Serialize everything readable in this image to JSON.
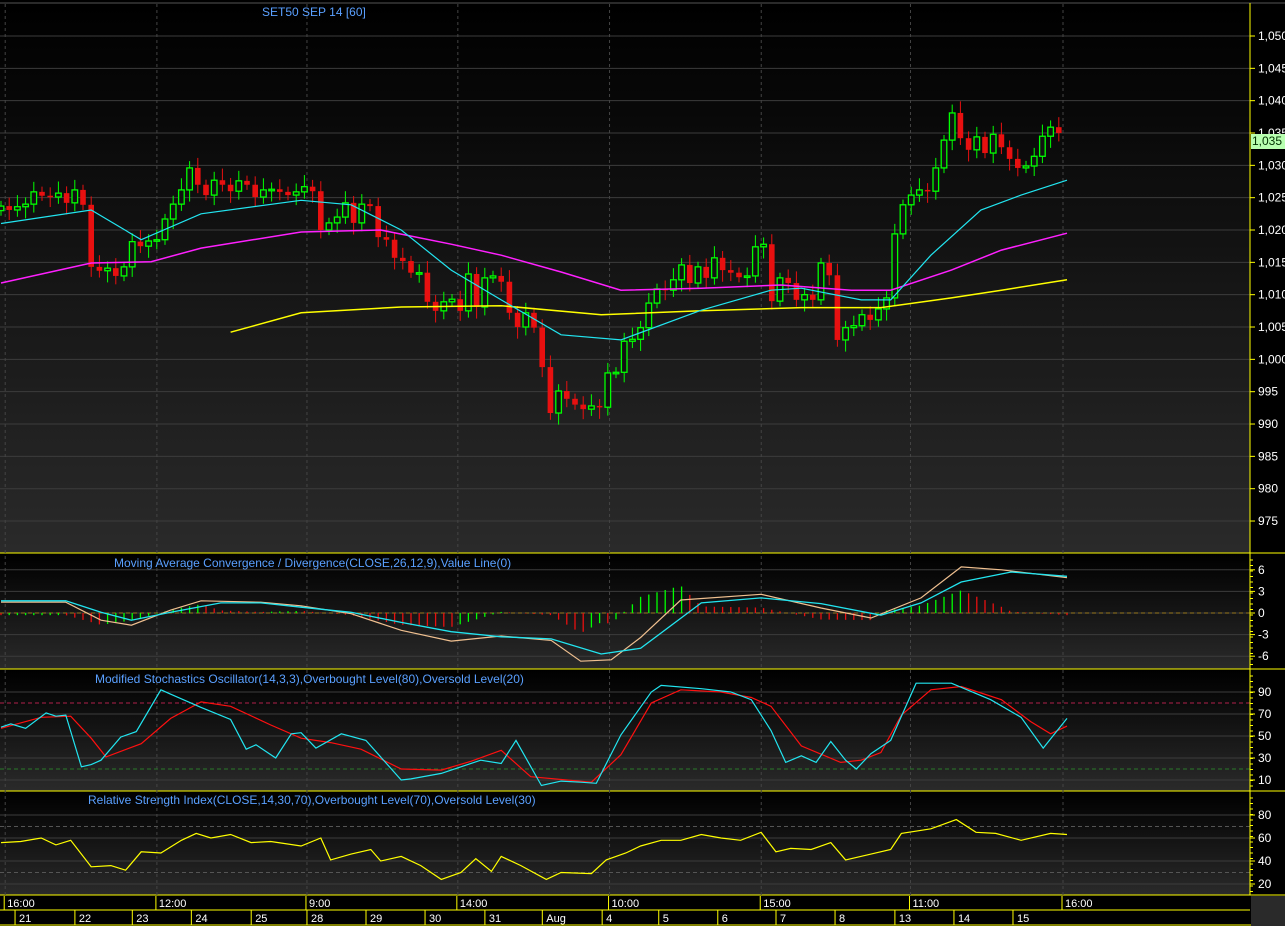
{
  "title": "SET50 SEP 14   [60]",
  "current_price_label": "1,035",
  "colors": {
    "up": "#00ff00",
    "down": "#e81010",
    "ma_fast": "#22e5f0",
    "ma_mid": "#ff20ff",
    "ma_slow": "#ffff00",
    "axis": "#ffff00",
    "title": "#5aa0ff"
  },
  "panels": {
    "macd_title": "Moving Average Convergence / Divergence(CLOSE,26,12,9),Value Line(0)",
    "stoch_title": "Modified Stochastics Oscillator(14,3,3),Overbought Level(80),Oversold Level(20)",
    "rsi_title": "Relative Strength Index(CLOSE,14,30,70),Overbought Level(70),Oversold Level(30)"
  },
  "time_axis": {
    "time_labels": [
      {
        "bar": 1,
        "label": "16:00"
      },
      {
        "bar": 19.5,
        "label": "12:00"
      },
      {
        "bar": 37.8,
        "label": "9:00"
      },
      {
        "bar": 56.2,
        "label": "14:00"
      },
      {
        "bar": 74.7,
        "label": "10:00"
      },
      {
        "bar": 93.2,
        "label": "15:00"
      },
      {
        "bar": 111.4,
        "label": "11:00"
      },
      {
        "bar": 130,
        "label": "16:00"
      }
    ],
    "date_labels": [
      {
        "bar": 2.2,
        "label": "21"
      },
      {
        "bar": 9.5,
        "label": "22"
      },
      {
        "bar": 16.5,
        "label": "23"
      },
      {
        "bar": 23.7,
        "label": "24"
      },
      {
        "bar": 31,
        "label": "25"
      },
      {
        "bar": 37.8,
        "label": "28"
      },
      {
        "bar": 45,
        "label": "29"
      },
      {
        "bar": 52.2,
        "label": "30"
      },
      {
        "bar": 59.5,
        "label": "31"
      },
      {
        "bar": 66.5,
        "label": "Aug"
      },
      {
        "bar": 73.8,
        "label": "4"
      },
      {
        "bar": 80.7,
        "label": "5"
      },
      {
        "bar": 87.9,
        "label": "6"
      },
      {
        "bar": 95,
        "label": "7"
      },
      {
        "bar": 102.2,
        "label": "8"
      },
      {
        "bar": 109.5,
        "label": "13"
      },
      {
        "bar": 116.7,
        "label": "14"
      },
      {
        "bar": 123.9,
        "label": "15"
      }
    ]
  },
  "chart_data": [
    {
      "type": "candlestick",
      "title": "SET50 SEP 14   [60]",
      "ylim": [
        972,
        1055
      ],
      "y_ticks": [
        {
          "v": 1050,
          "label": "1,050"
        },
        {
          "v": 1045,
          "label": "1,045"
        },
        {
          "v": 1040,
          "label": "1,040"
        },
        {
          "v": 1035,
          "label": "1,035"
        },
        {
          "v": 1030,
          "label": "1,030"
        },
        {
          "v": 1025,
          "label": "1,025"
        },
        {
          "v": 1020,
          "label": "1,020"
        },
        {
          "v": 1015,
          "label": "1,015"
        },
        {
          "v": 1010,
          "label": "1,010"
        },
        {
          "v": 1005,
          "label": "1,005"
        },
        {
          "v": 1000,
          "label": "1,000"
        },
        {
          "v": 995,
          "label": "995"
        },
        {
          "v": 990,
          "label": "990"
        },
        {
          "v": 985,
          "label": "985"
        },
        {
          "v": 980,
          "label": "980"
        },
        {
          "v": 975,
          "label": "975"
        }
      ],
      "first_open": 1023.0,
      "close": [
        1023.7,
        1023.1,
        1023.6,
        1024.0,
        1025.9,
        1025.3,
        1025.1,
        1025.7,
        1024.2,
        1026.2,
        1023.9,
        1014.3,
        1013.7,
        1014.1,
        1012.9,
        1014.3,
        1018.2,
        1017.5,
        1018.3,
        1018.5,
        1021.7,
        1024.0,
        1026.2,
        1029.6,
        1027.0,
        1025.4,
        1027.7,
        1027.0,
        1026.0,
        1027.6,
        1027.0,
        1025.1,
        1026.2,
        1026.3,
        1025.9,
        1025.4,
        1025.9,
        1026.7,
        1026.0,
        1020.0,
        1021.1,
        1022.0,
        1024.2,
        1021.1,
        1024.0,
        1023.7,
        1018.9,
        1018.5,
        1015.7,
        1015.2,
        1013.4,
        1013.4,
        1008.9,
        1007.5,
        1008.9,
        1009.3,
        1007.5,
        1013.2,
        1008.1,
        1012.6,
        1012.9,
        1012.0,
        1007.2,
        1005.0,
        1007.2,
        1004.9,
        998.8,
        991.7,
        995.1,
        993.9,
        993.0,
        992.3,
        992.8,
        992.6,
        997.9,
        998.0,
        1002.8,
        1003.1,
        1004.9,
        1008.7,
        1010.9,
        1010.7,
        1012.3,
        1014.6,
        1011.8,
        1014.3,
        1012.6,
        1015.7,
        1013.8,
        1013.4,
        1012.7,
        1012.9,
        1017.4,
        1017.8,
        1009.0,
        1012.6,
        1011.8,
        1009.2,
        1010.0,
        1009.2,
        1014.9,
        1013.0,
        1003.0,
        1004.9,
        1005.2,
        1006.9,
        1006.1,
        1007.8,
        1009.5,
        1019.4,
        1023.9,
        1025.4,
        1026.2,
        1026.0,
        1029.6,
        1033.9,
        1038.1,
        1034.2,
        1032.4,
        1034.4,
        1031.9,
        1034.8,
        1032.8,
        1031.0,
        1029.6,
        1029.9,
        1031.4,
        1034.5,
        1035.9,
        1035.0
      ],
      "ma_fast": [
        [
          0,
          1021.0
        ],
        [
          11,
          1023.1
        ],
        [
          17.1,
          1018.5
        ],
        [
          24.4,
          1022.5
        ],
        [
          36.6,
          1024.6
        ],
        [
          42.7,
          1023.9
        ],
        [
          48.8,
          1020.0
        ],
        [
          54.9,
          1013.8
        ],
        [
          61,
          1009.2
        ],
        [
          68.3,
          1003.8
        ],
        [
          75.6,
          1003.0
        ],
        [
          85.4,
          1007.6
        ],
        [
          93.9,
          1010.7
        ],
        [
          97.6,
          1011.0
        ],
        [
          104.9,
          1009.2
        ],
        [
          108.5,
          1009.2
        ],
        [
          113.4,
          1016.1
        ],
        [
          119.5,
          1023.1
        ],
        [
          124.4,
          1025.4
        ],
        [
          130,
          1027.7
        ]
      ],
      "ma_mid": [
        [
          0,
          1011.8
        ],
        [
          11,
          1014.9
        ],
        [
          18.3,
          1015.1
        ],
        [
          24.4,
          1017.2
        ],
        [
          36.6,
          1019.7
        ],
        [
          46.3,
          1020.0
        ],
        [
          54.9,
          1017.8
        ],
        [
          61,
          1016.1
        ],
        [
          68.3,
          1013.5
        ],
        [
          75.6,
          1010.7
        ],
        [
          85.4,
          1011.0
        ],
        [
          95.1,
          1011.5
        ],
        [
          103.7,
          1010.7
        ],
        [
          108.5,
          1010.7
        ],
        [
          115.9,
          1013.8
        ],
        [
          122,
          1016.9
        ],
        [
          130,
          1019.5
        ]
      ],
      "ma_slow": [
        [
          28,
          1004.2
        ],
        [
          36.6,
          1007.2
        ],
        [
          48.8,
          1008.1
        ],
        [
          61,
          1008.3
        ],
        [
          73.2,
          1006.9
        ],
        [
          85.4,
          1007.5
        ],
        [
          97.6,
          1008.0
        ],
        [
          107.3,
          1008.0
        ],
        [
          115.9,
          1009.5
        ],
        [
          122,
          1010.7
        ],
        [
          130,
          1012.3
        ]
      ]
    },
    {
      "type": "line",
      "title": "Moving Average Convergence / Divergence(CLOSE,26,12,9),Value Line(0)",
      "ylim": [
        -7.5,
        8
      ],
      "y_ticks": [
        {
          "v": 6,
          "label": "6"
        },
        {
          "v": 3,
          "label": "3"
        },
        {
          "v": 0,
          "label": "0"
        },
        {
          "v": -3,
          "label": "-3"
        },
        {
          "v": -6,
          "label": "-6"
        }
      ],
      "macd": [
        [
          0,
          1.5
        ],
        [
          7.9,
          1.5
        ],
        [
          12.2,
          -1.0
        ],
        [
          15.9,
          -1.7
        ],
        [
          20.7,
          0.4
        ],
        [
          24.4,
          1.7
        ],
        [
          31.7,
          1.5
        ],
        [
          36.6,
          1.0
        ],
        [
          42.7,
          -0.1
        ],
        [
          48.8,
          -2.4
        ],
        [
          54.9,
          -3.9
        ],
        [
          61,
          -3.2
        ],
        [
          67.1,
          -3.8
        ],
        [
          70.7,
          -6.7
        ],
        [
          74.4,
          -6.5
        ],
        [
          78,
          -3.4
        ],
        [
          82.9,
          1.8
        ],
        [
          92.7,
          2.6
        ],
        [
          100,
          0.7
        ],
        [
          106.1,
          -0.7
        ],
        [
          112.2,
          2.1
        ],
        [
          117.1,
          6.4
        ],
        [
          122,
          6.0
        ],
        [
          130,
          4.9
        ]
      ],
      "signal": [
        [
          0,
          1.7
        ],
        [
          7.9,
          1.7
        ],
        [
          12.2,
          0.1
        ],
        [
          15.9,
          -1.0
        ],
        [
          20.7,
          0.1
        ],
        [
          26.8,
          1.4
        ],
        [
          31.7,
          1.4
        ],
        [
          36.6,
          0.8
        ],
        [
          42.7,
          0.1
        ],
        [
          48.8,
          -1.3
        ],
        [
          54.9,
          -2.6
        ],
        [
          61,
          -3.3
        ],
        [
          67.1,
          -3.6
        ],
        [
          73.2,
          -5.7
        ],
        [
          78,
          -4.9
        ],
        [
          85.4,
          1.4
        ],
        [
          92.7,
          2.1
        ],
        [
          100,
          1.3
        ],
        [
          107.3,
          -0.3
        ],
        [
          112.2,
          1.4
        ],
        [
          117.1,
          4.3
        ],
        [
          123.2,
          5.7
        ],
        [
          130,
          5.1
        ]
      ],
      "value_line": 0
    },
    {
      "type": "line",
      "title": "Modified Stochastics Oscillator(14,3,3),Overbought Level(80),Oversold Level(20)",
      "ylim": [
        0,
        105
      ],
      "y_ticks": [
        {
          "v": 90,
          "label": "90"
        },
        {
          "v": 70,
          "label": "70"
        },
        {
          "v": 50,
          "label": "50"
        },
        {
          "v": 30,
          "label": "30"
        },
        {
          "v": 10,
          "label": "10"
        }
      ],
      "overbought": 80,
      "oversold": 20,
      "k": [
        [
          0,
          58
        ],
        [
          1.2,
          61
        ],
        [
          3,
          57
        ],
        [
          5.5,
          71
        ],
        [
          6.7,
          68
        ],
        [
          7.9,
          69
        ],
        [
          9.8,
          22
        ],
        [
          11,
          24
        ],
        [
          12.2,
          28
        ],
        [
          14.6,
          49
        ],
        [
          16.5,
          54
        ],
        [
          19.5,
          92
        ],
        [
          20.7,
          88
        ],
        [
          24.4,
          76
        ],
        [
          28,
          65
        ],
        [
          29.9,
          38
        ],
        [
          31.1,
          42
        ],
        [
          33.5,
          30
        ],
        [
          35.4,
          52
        ],
        [
          36.6,
          53
        ],
        [
          38.4,
          39
        ],
        [
          41.5,
          52
        ],
        [
          44.5,
          46
        ],
        [
          48.8,
          10
        ],
        [
          50,
          11
        ],
        [
          53.7,
          16
        ],
        [
          56.1,
          22
        ],
        [
          58.5,
          28
        ],
        [
          61,
          25
        ],
        [
          62.8,
          46
        ],
        [
          65.9,
          5
        ],
        [
          68.3,
          9
        ],
        [
          70.7,
          8
        ],
        [
          72.6,
          7
        ],
        [
          75.6,
          51
        ],
        [
          79.3,
          90
        ],
        [
          80.5,
          96
        ],
        [
          85.4,
          93
        ],
        [
          89,
          90
        ],
        [
          91.5,
          83
        ],
        [
          93.9,
          55
        ],
        [
          95.7,
          26
        ],
        [
          97.6,
          32
        ],
        [
          99.4,
          26
        ],
        [
          101.2,
          45
        ],
        [
          103,
          28
        ],
        [
          104.3,
          20
        ],
        [
          106.1,
          34
        ],
        [
          108.5,
          46
        ],
        [
          111.6,
          98
        ],
        [
          115.9,
          98
        ],
        [
          120.7,
          83
        ],
        [
          124.4,
          67
        ],
        [
          127.1,
          39
        ],
        [
          130,
          66
        ]
      ],
      "d": [
        [
          0,
          57
        ],
        [
          4.9,
          67
        ],
        [
          8.5,
          68
        ],
        [
          11,
          48
        ],
        [
          12.8,
          31
        ],
        [
          17.1,
          43
        ],
        [
          20.7,
          66
        ],
        [
          24.4,
          81
        ],
        [
          28,
          77
        ],
        [
          32.9,
          60
        ],
        [
          36.6,
          48
        ],
        [
          40.2,
          44
        ],
        [
          43.9,
          38
        ],
        [
          48.8,
          20
        ],
        [
          53.7,
          19
        ],
        [
          57.3,
          27
        ],
        [
          61,
          37
        ],
        [
          64.6,
          13
        ],
        [
          72,
          8
        ],
        [
          75.6,
          33
        ],
        [
          79.3,
          80
        ],
        [
          82.9,
          92
        ],
        [
          87.8,
          90
        ],
        [
          91.5,
          85
        ],
        [
          93.9,
          77
        ],
        [
          97.6,
          41
        ],
        [
          102.4,
          26
        ],
        [
          104.9,
          28
        ],
        [
          107.3,
          35
        ],
        [
          109.8,
          69
        ],
        [
          113.4,
          92
        ],
        [
          117.1,
          95
        ],
        [
          122,
          83
        ],
        [
          125.6,
          63
        ],
        [
          128,
          52
        ],
        [
          130,
          59
        ]
      ]
    },
    {
      "type": "line",
      "title": "Relative Strength Index(CLOSE,14,30,70),Overbought Level(70),Oversold Level(30)",
      "ylim": [
        12,
        92
      ],
      "y_ticks": [
        {
          "v": 80,
          "label": "80"
        },
        {
          "v": 60,
          "label": "60"
        },
        {
          "v": 40,
          "label": "40"
        },
        {
          "v": 20,
          "label": "20"
        }
      ],
      "overbought": 70,
      "oversold": 30,
      "rsi": [
        [
          0,
          56
        ],
        [
          2.4,
          57
        ],
        [
          4.9,
          60
        ],
        [
          6.7,
          54
        ],
        [
          8.5,
          58
        ],
        [
          11,
          35
        ],
        [
          13.4,
          36
        ],
        [
          15.2,
          32
        ],
        [
          17.1,
          48
        ],
        [
          19.5,
          47
        ],
        [
          22,
          58
        ],
        [
          23.8,
          64
        ],
        [
          25.6,
          60
        ],
        [
          28,
          63
        ],
        [
          30.5,
          56
        ],
        [
          32.9,
          57
        ],
        [
          36.6,
          53
        ],
        [
          39,
          60
        ],
        [
          40.2,
          41
        ],
        [
          42.7,
          46
        ],
        [
          45.1,
          50
        ],
        [
          46.3,
          40
        ],
        [
          48.8,
          44
        ],
        [
          51.2,
          36
        ],
        [
          53.7,
          24
        ],
        [
          56.1,
          30
        ],
        [
          57.9,
          42
        ],
        [
          59.8,
          31
        ],
        [
          61,
          44
        ],
        [
          63.4,
          36
        ],
        [
          66.5,
          24
        ],
        [
          68.3,
          30
        ],
        [
          72,
          29
        ],
        [
          73.8,
          41
        ],
        [
          76.2,
          47
        ],
        [
          78,
          53
        ],
        [
          80.5,
          58
        ],
        [
          82.9,
          58
        ],
        [
          85.4,
          63
        ],
        [
          87.8,
          60
        ],
        [
          90.2,
          58
        ],
        [
          92.7,
          65
        ],
        [
          94.5,
          48
        ],
        [
          96.3,
          51
        ],
        [
          98.8,
          50
        ],
        [
          101.2,
          56
        ],
        [
          103,
          41
        ],
        [
          106.1,
          46
        ],
        [
          108.5,
          50
        ],
        [
          109.8,
          64
        ],
        [
          113.4,
          68
        ],
        [
          116.5,
          76
        ],
        [
          118.9,
          65
        ],
        [
          121.3,
          64
        ],
        [
          124.4,
          58
        ],
        [
          128,
          64
        ],
        [
          130,
          63
        ]
      ]
    }
  ]
}
